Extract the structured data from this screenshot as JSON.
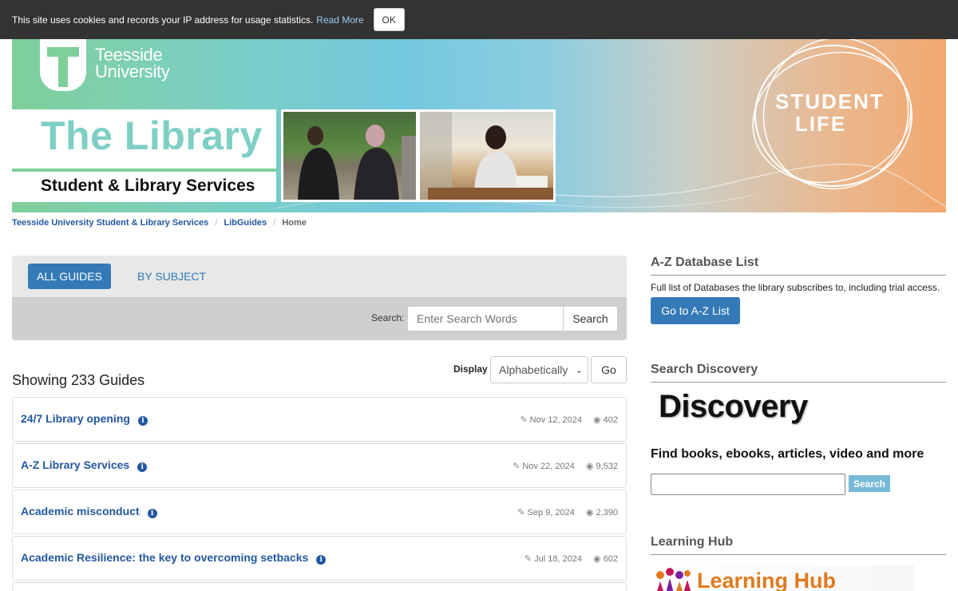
{
  "cookie": {
    "message": "This site uses cookies and records your IP address for usage statistics.",
    "read_more": "Read More",
    "ok": "OK"
  },
  "banner": {
    "university_line1": "Teesside",
    "university_line2": "University",
    "library_title": "The Library",
    "subtitle": "Student & Library Services",
    "badge_line1": "STUDENT",
    "badge_line2": "LIFE"
  },
  "breadcrumb": {
    "items": [
      "Teesside University Student & Library Services",
      "LibGuides"
    ],
    "current": "Home"
  },
  "guides_panel": {
    "tab_all": "ALL GUIDES",
    "tab_subject": "BY SUBJECT",
    "search_label": "Search:",
    "search_placeholder": "Enter Search Words",
    "search_button": "Search"
  },
  "listing": {
    "showing": "Showing 233 Guides",
    "display_label": "Display",
    "display_value": "Alphabetically",
    "go_button": "Go"
  },
  "guides": [
    {
      "name": "24/7 Library opening",
      "date": "Nov 12, 2024",
      "views": "402"
    },
    {
      "name": "A-Z Library Services",
      "date": "Nov 22, 2024",
      "views": "9,532"
    },
    {
      "name": "Academic misconduct",
      "date": "Sep 9, 2024",
      "views": "2,390"
    },
    {
      "name": "Academic Resilience: the key to overcoming setbacks",
      "date": "Jul 18, 2024",
      "views": "602"
    }
  ],
  "sidebar": {
    "az": {
      "heading": "A-Z Database List",
      "description": "Full list of Databases the library subscribes to, including trial access.",
      "button": "Go to A-Z List"
    },
    "discovery": {
      "heading": "Search Discovery",
      "logo_text": "Discovery",
      "tagline": "Find books, ebooks, articles, video and more",
      "button": "Search"
    },
    "learning_hub": {
      "heading": "Learning Hub",
      "logo_text": "Learning Hub"
    }
  },
  "colors": {
    "primary": "#337ab7",
    "link": "#23589f",
    "cookie_bar": "#333333",
    "discovery_button": "#76b9d8",
    "learning_hub_orange": "#e07a1f"
  },
  "icons": {
    "guide_info": "info-circle-icon",
    "updated": "edit-icon",
    "views": "eye-icon"
  }
}
